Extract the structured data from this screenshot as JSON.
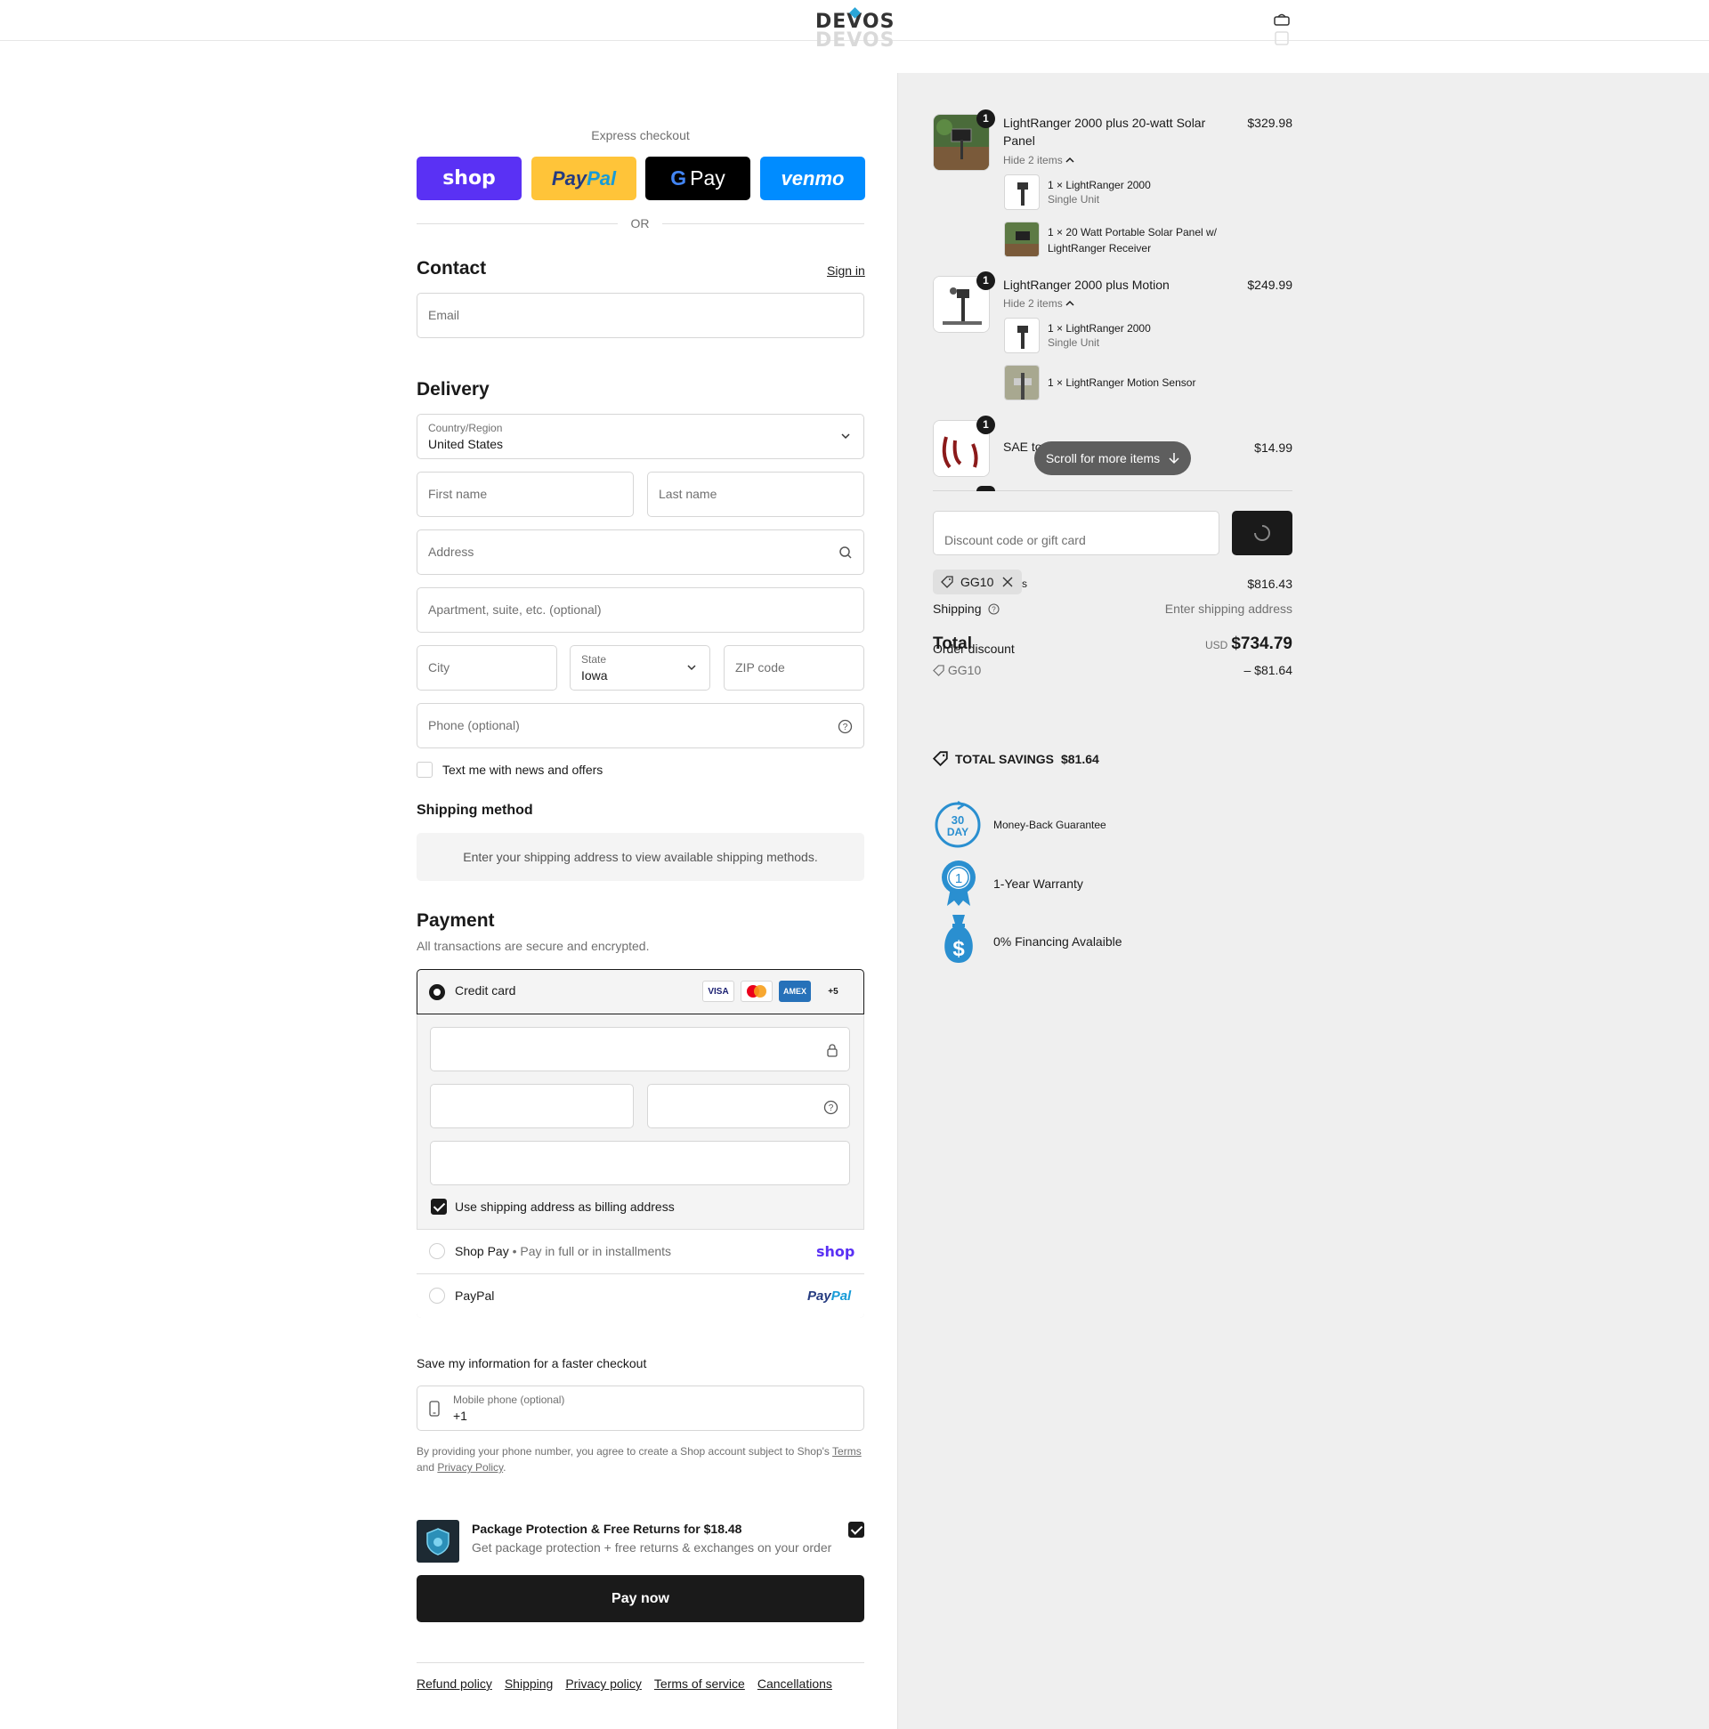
{
  "header": {
    "logo": "DEVOS"
  },
  "express": {
    "title": "Express checkout",
    "shop_label": "shop",
    "paypal_a": "Pay",
    "paypal_b": "Pal",
    "gpay_label": "Pay",
    "venmo_label": "venmo",
    "or": "OR"
  },
  "contact": {
    "title": "Contact",
    "sign_in": "Sign in",
    "email_placeholder": "Email"
  },
  "delivery": {
    "title": "Delivery",
    "country_label": "Country/Region",
    "country_value": "United States",
    "first_name": "First name",
    "last_name": "Last name",
    "address": "Address",
    "apartment": "Apartment, suite, etc. (optional)",
    "city": "City",
    "state_label": "State",
    "state_value": "Iowa",
    "zip": "ZIP code",
    "phone": "Phone (optional)",
    "text_me": "Text me with news and offers"
  },
  "shipping_method": {
    "title": "Shipping method",
    "message": "Enter your shipping address to view available shipping methods."
  },
  "payment": {
    "title": "Payment",
    "subtitle": "All transactions are secure and encrypted.",
    "credit_card": "Credit card",
    "cards": [
      "VISA",
      "MC",
      "AMEX",
      "+5"
    ],
    "billing_same": "Use shipping address as billing address",
    "shop_pay": "Shop Pay",
    "shop_pay_desc": "Pay in full or in installments",
    "shop_pay_logo": "shop",
    "paypal": "PayPal",
    "paypal_logo_a": "Pay",
    "paypal_logo_b": "Pal"
  },
  "save_info": {
    "title": "Save my information for a faster checkout",
    "mobile_label": "Mobile phone (optional)",
    "mobile_value": "+1",
    "legal_1": "By providing your phone number, you agree to create a Shop account subject to Shop's",
    "terms": "Terms",
    "and": "and",
    "privacy": "Privacy Policy",
    "period": "."
  },
  "protection": {
    "title": "Package Protection & Free Returns for $18.48",
    "desc": "Get package protection + free returns & exchanges on your order"
  },
  "pay_now": "Pay now",
  "footer_links": [
    "Refund policy",
    "Shipping",
    "Privacy policy",
    "Terms of service",
    "Cancellations"
  ],
  "summary": {
    "items": [
      {
        "qty": "1",
        "name": "LightRanger 2000 plus 20-watt Solar Panel",
        "price": "$329.98",
        "hide": "Hide 2 items",
        "sub": [
          {
            "name": "1 × LightRanger 2000",
            "variant": "Single Unit"
          },
          {
            "name": "1 × 20 Watt Portable Solar Panel w/ LightRanger Receiver",
            "variant": ""
          }
        ]
      },
      {
        "qty": "1",
        "name": "LightRanger 2000 plus Motion",
        "price": "$249.99",
        "hide": "Hide 2 items",
        "sub": [
          {
            "name": "1 × LightRanger 2000",
            "variant": "Single Unit"
          },
          {
            "name": "1 × LightRanger Motion Sensor",
            "variant": ""
          }
        ]
      },
      {
        "qty": "1",
        "name": "SAE to",
        "price": "$14.99"
      }
    ],
    "scroll_pill": "Scroll for more items",
    "discount_placeholder": "Discount code or gift card",
    "applied_code": "GG10",
    "subtotal_suffix": "s",
    "subtotal_value": "$816.43",
    "shipping_label": "Shipping",
    "shipping_value": "Enter shipping address",
    "total_label": "Total",
    "order_discount_label": "Order discount",
    "currency": "USD",
    "total_value": "$734.79",
    "discount_code": "GG10",
    "discount_value": "– $81.64",
    "savings_label": "TOTAL SAVINGS",
    "savings_value": "$81.64"
  },
  "guarantees": [
    {
      "icon": "30-day-badge-icon",
      "badge_top": "30",
      "badge_bottom": "DAY",
      "text": "Money-Back Guarantee"
    },
    {
      "icon": "warranty-ribbon-icon",
      "badge_top": "1",
      "text": "1-Year Warranty"
    },
    {
      "icon": "money-bag-icon",
      "badge_top": "$",
      "text": "0% Financing Avalaible"
    }
  ],
  "colors": {
    "shop": "#5a31f4",
    "paypal": "#ffc439",
    "venmo": "#008cff",
    "accent_blue": "#2a8fd0"
  }
}
